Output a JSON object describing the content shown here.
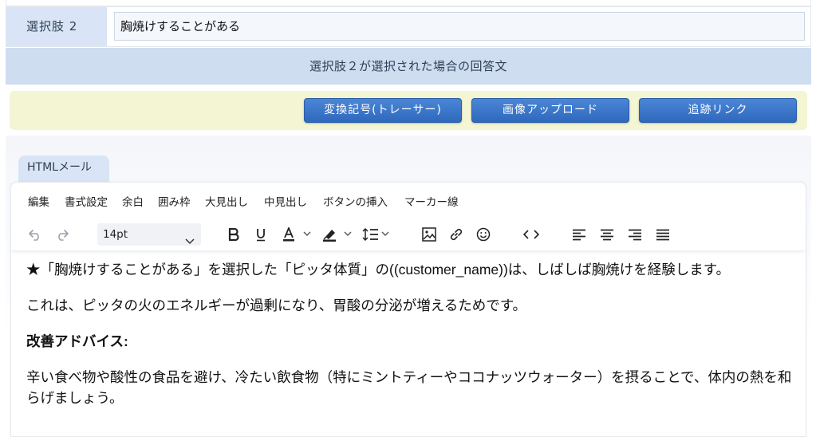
{
  "choice": {
    "label": "選択肢 2",
    "value": "胸焼けすることがある"
  },
  "answer_header": "選択肢２が選択された場合の回答文",
  "action_buttons": [
    "変換記号(トレーサー)",
    "画像アップロード",
    "追跡リンク"
  ],
  "editor_tab": "HTMLメール",
  "menu": [
    "編集",
    "書式設定",
    "余白",
    "囲み枠",
    "大見出し",
    "中見出し",
    "ボタンの挿入",
    "マーカー線"
  ],
  "toolbar": {
    "font_size": "14pt",
    "icons": [
      "undo-icon",
      "redo-icon",
      "bold-icon",
      "underline-icon",
      "text-color-icon",
      "highlight-icon",
      "line-height-icon",
      "image-icon",
      "link-icon",
      "emoji-icon",
      "code-icon",
      "align-left-icon",
      "align-center-icon",
      "align-right-icon",
      "align-justify-icon"
    ]
  },
  "content": {
    "p1": "★「胸焼けすることがある」を選択した「ピッタ体質」の((customer_name))は、しばしば胸焼けを経験します。",
    "p2": "これは、ピッタの火のエネルギーが過剰になり、胃酸の分泌が増えるためです。",
    "p3": "改善アドバイス:",
    "p4": "辛い食べ物や酸性の食品を避け、冷たい飲食物（特にミントティーやココナッツウォーター）を摂ることで、体内の熱を和らげましょう。"
  },
  "colors": {
    "label_bg": "#d9e5f6",
    "header_bg": "#cfddf1",
    "button_bar_bg": "#f4f5d2",
    "button_bg": "#3a76c9"
  }
}
